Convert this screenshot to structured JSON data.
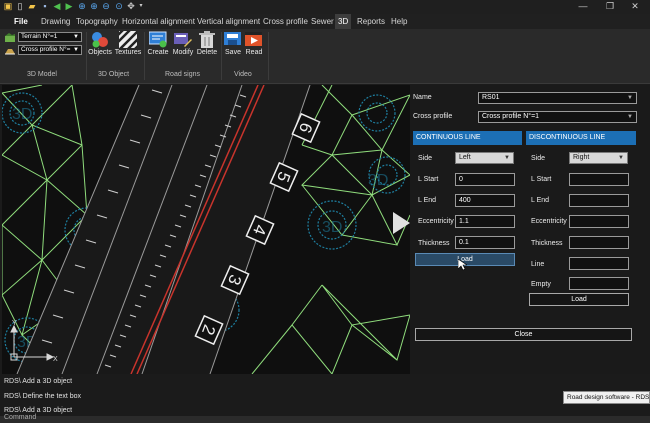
{
  "menu": {
    "file": "File",
    "items": [
      "Drawing",
      "Topography",
      "Horizontal alignment",
      "Vertical alignment",
      "Cross profile",
      "Sewer",
      "3D",
      "Reports",
      "Help"
    ]
  },
  "ribbon": {
    "terrain_select": "Terrain N°=1",
    "profile_select": "Cross profile N°=",
    "buttons": {
      "objects": "Objects",
      "textures": "Textures",
      "create": "Create",
      "modify": "Modify",
      "delete": "Delete",
      "save": "Save",
      "read": "Read"
    },
    "groups": {
      "model": "3D Model",
      "object": "3D Object",
      "road_signs": "Road signs",
      "video": "Video"
    }
  },
  "viewport": {
    "station_labels": [
      "6",
      "5",
      "4",
      "3",
      "2"
    ],
    "watermark": "3D",
    "axis_y": "Y",
    "axis_x": "X"
  },
  "panel": {
    "name_label": "Name",
    "name_value": "RS01",
    "profile_label": "Cross profile",
    "profile_value": "Cross profile N°=1",
    "continuous": {
      "header": "CONTINUOUS LINE",
      "side_label": "Side",
      "side_value": "Left",
      "lstart_label": "L Start",
      "lstart_value": "0",
      "lend_label": "L End",
      "lend_value": "400",
      "ecc_label": "Eccentricity",
      "ecc_value": "1.1",
      "thick_label": "Thickness",
      "thick_value": "0.1",
      "load_label": "Load"
    },
    "discontinuous": {
      "header": "DISCONTINUOUS LINE",
      "side_label": "Side",
      "side_value": "Right",
      "lstart_label": "L Start",
      "lend_label": "L End",
      "ecc_label": "Eccentricity",
      "thick_label": "Thickness",
      "line_label": "Line",
      "empty_label": "Empty",
      "load_label": "Load"
    },
    "close_label": "Close"
  },
  "log": [
    "RDS\\ Add a 3D object",
    "RDS\\ Define the text box",
    "RDS\\ Add a 3D object"
  ],
  "command_label": "Command",
  "tooltip": "Road design software - RDS",
  "colors": {
    "accent": "#1c6fb5",
    "terrain_lines": "#8fdc7c",
    "centerline": "#c8342c",
    "trees": "#1e7fa0"
  }
}
